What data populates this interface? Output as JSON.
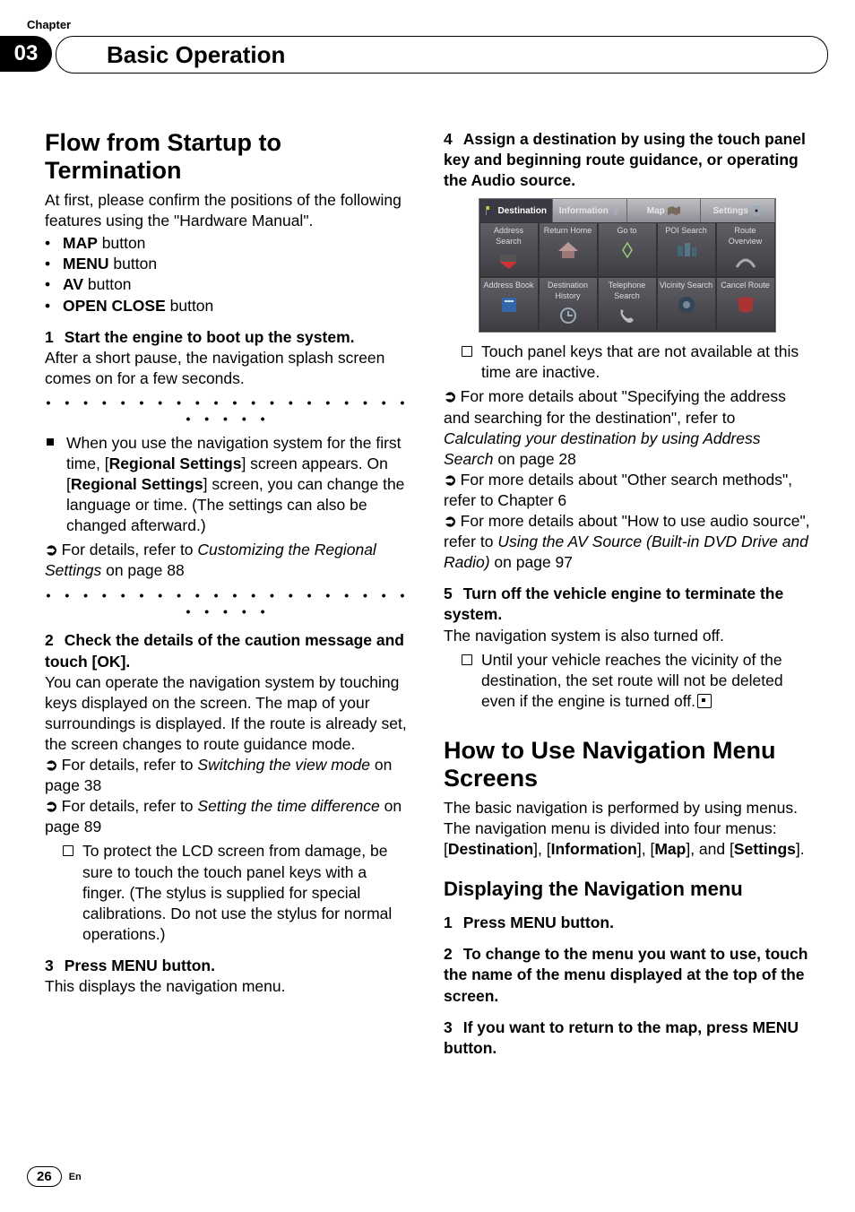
{
  "chapter_label": "Chapter",
  "chapter_number": "03",
  "chapter_title": "Basic Operation",
  "page_number": "26",
  "lang_code": "En",
  "left": {
    "h1": "Flow from Startup to Termination",
    "intro": "At first, please confirm the positions of the following features using the \"Hardware Manual\".",
    "buttons": [
      {
        "bold": "MAP",
        "rest": " button"
      },
      {
        "bold": "MENU",
        "rest": " button"
      },
      {
        "bold": "AV",
        "rest": " button"
      },
      {
        "bold": "OPEN CLOSE",
        "rest": " button"
      }
    ],
    "step1_head_num": "1",
    "step1_head": "Start the engine to boot up the system.",
    "step1_body": "After a short pause, the navigation splash screen comes on for a few seconds.",
    "note1_pre": "When you use the navigation system for the first time, [",
    "note1_bold1": "Regional Settings",
    "note1_mid1": "] screen appears. On [",
    "note1_bold2": "Regional Settings",
    "note1_mid2": "] screen, you can change the language or time. (The settings can also be changed afterward.)",
    "ref1_pre": "For details, refer to ",
    "ref1_ital": "Customizing the Regional Settings",
    "ref1_post": " on page 88",
    "step2_head_num": "2",
    "step2_head": "Check the details of the caution message and touch [OK].",
    "step2_body": "You can operate the navigation system by touching keys displayed on the screen. The map of your surroundings is displayed. If the route is already set, the screen changes to route guidance mode.",
    "ref2_pre": "For details, refer to ",
    "ref2_ital": "Switching the view mode",
    "ref2_post": " on page 38",
    "ref3_pre": "For details, refer to ",
    "ref3_ital": "Setting the time difference",
    "ref3_post": " on page 89",
    "tip1": "To protect the LCD screen from damage, be sure to touch the touch panel keys with a finger. (The stylus is supplied for special calibrations. Do not use the stylus for normal operations.)",
    "step3_head_num": "3",
    "step3_head": "Press MENU button.",
    "step3_body": "This displays the navigation menu."
  },
  "right": {
    "step4_head_num": "4",
    "step4_head": "Assign a destination by using the touch panel key and beginning route guidance, or operating the Audio source.",
    "shot": {
      "tabs": [
        "Destination",
        "Information",
        "Map",
        "Settings"
      ],
      "row1": [
        "Address Search",
        "Return Home",
        "Go to",
        "POI Search",
        "Route Overview"
      ],
      "row2": [
        "Address Book",
        "Destination History",
        "Telephone Search",
        "Vicinity Search",
        "Cancel Route"
      ]
    },
    "tip2": "Touch panel keys that are not available at this time are inactive.",
    "ref4_pre": "For more details about \"Specifying the address and searching for the destination\", refer to ",
    "ref4_ital": "Calculating your destination by using Address Search",
    "ref4_post": " on page 28",
    "ref5": "For more details about \"Other search methods\", refer to Chapter 6",
    "ref6_pre": "For more details about \"How to use audio source\", refer to ",
    "ref6_ital": "Using the AV Source (Built-in DVD Drive and Radio)",
    "ref6_post": " on page 97",
    "step5_head_num": "5",
    "step5_head": "Turn off the vehicle engine to terminate the system.",
    "step5_body": "The navigation system is also turned off.",
    "tip3": "Until your vehicle reaches the vicinity of the destination, the set route will not be deleted even if the engine is turned off.",
    "h2": "How to Use Navigation Menu Screens",
    "h2_body1": "The basic navigation is performed by using menus.",
    "h2_body2_pre": "The navigation menu is divided into four menus: [",
    "h2_b1": "Destination",
    "h2_m1": "], [",
    "h2_b2": "Information",
    "h2_m2": "], [",
    "h2_b3": "Map",
    "h2_m3": "], and [",
    "h2_b4": "Settings",
    "h2_m4": "].",
    "sub": "Displaying the Navigation menu",
    "s1_num": "1",
    "s1": "Press MENU button.",
    "s2_num": "2",
    "s2": "To change to the menu you want to use, touch the name of the menu displayed at the top of the screen.",
    "s3_num": "3",
    "s3": "If you want to return to the map, press MENU button."
  }
}
